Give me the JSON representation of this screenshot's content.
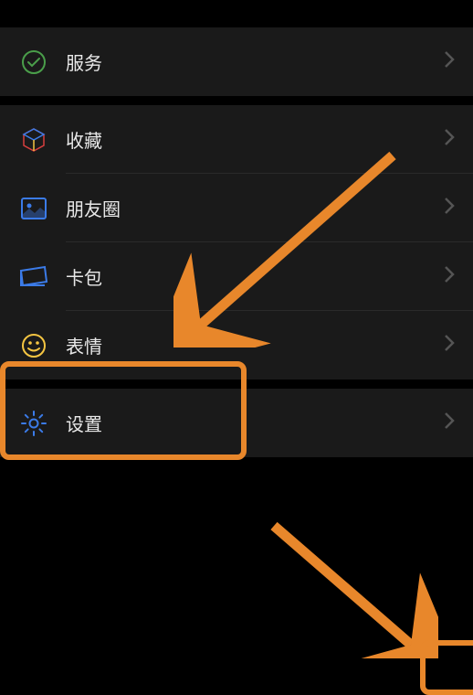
{
  "menu": {
    "services": {
      "label": "服务"
    },
    "favorites": {
      "label": "收藏"
    },
    "moments": {
      "label": "朋友圈"
    },
    "cards": {
      "label": "卡包"
    },
    "stickers": {
      "label": "表情"
    },
    "settings": {
      "label": "设置"
    }
  },
  "colors": {
    "accent": "#e8872b",
    "icon_blue": "#3b7be8",
    "icon_yellow": "#f5c542"
  }
}
